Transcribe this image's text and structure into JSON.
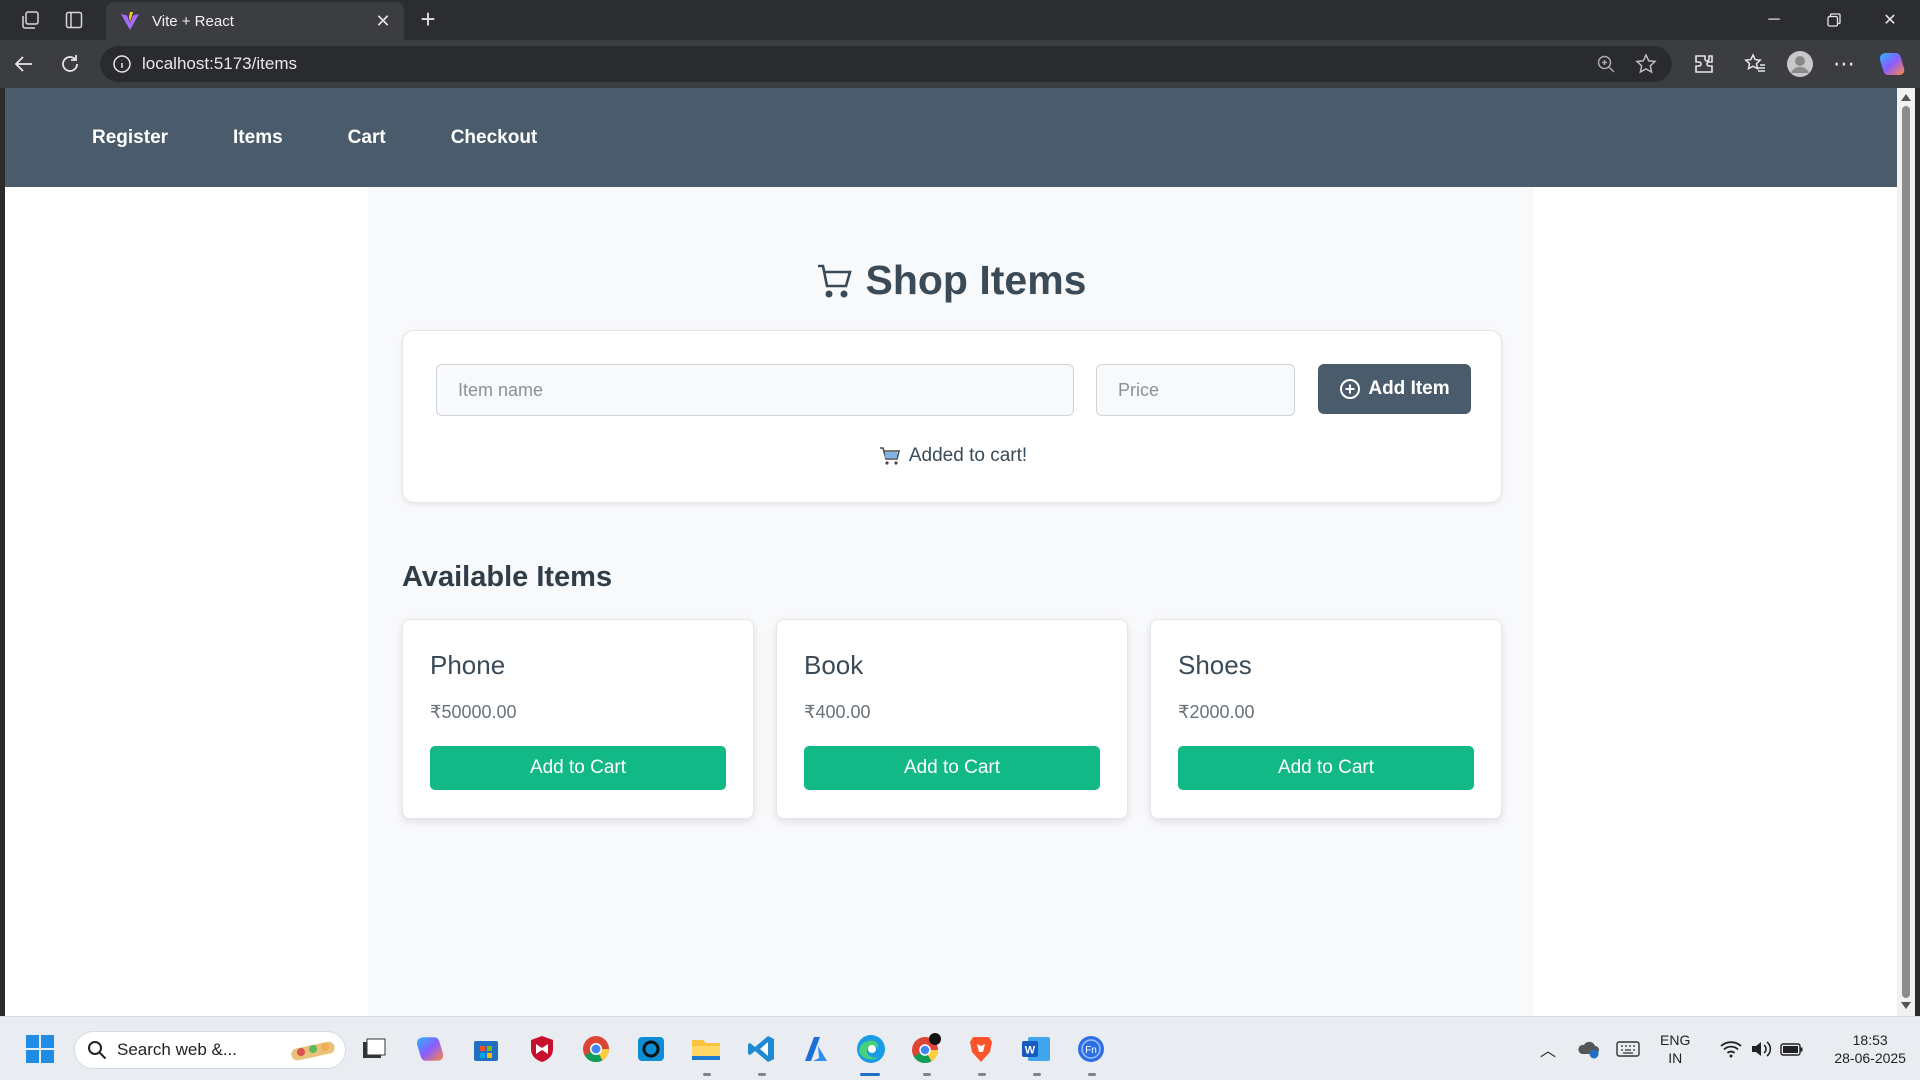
{
  "browser": {
    "tab_title": "Vite + React",
    "url": "localhost:5173/items"
  },
  "app": {
    "nav": [
      "Register",
      "Items",
      "Cart",
      "Checkout"
    ],
    "page_title": "Shop Items",
    "form": {
      "name_placeholder": "Item name",
      "price_placeholder": "Price",
      "add_button": "Add Item",
      "status": "Added to cart!"
    },
    "section_title": "Available Items",
    "items": [
      {
        "name": "Phone",
        "price": "₹50000.00",
        "button": "Add to Cart"
      },
      {
        "name": "Book",
        "price": "₹400.00",
        "button": "Add to Cart"
      },
      {
        "name": "Shoes",
        "price": "₹2000.00",
        "button": "Add to Cart"
      }
    ],
    "colors": {
      "nav_bg": "#4a5c6b",
      "accent_green": "#12b886"
    }
  },
  "taskbar": {
    "search_placeholder": "Search web &...",
    "lang_top": "ENG",
    "lang_bottom": "IN",
    "time": "18:53",
    "date": "28-06-2025"
  }
}
